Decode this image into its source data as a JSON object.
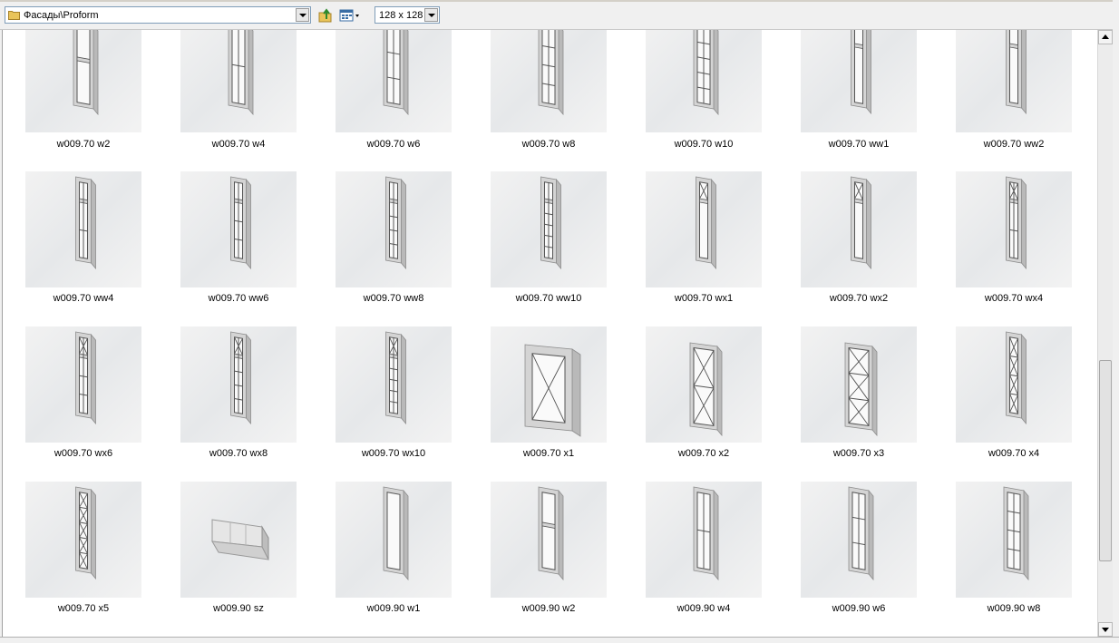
{
  "toolbar": {
    "path": "Фасады\\Proform",
    "view_size": "128 x 128",
    "icons": [
      "folder-icon",
      "up-folder-icon",
      "view-mode-icon",
      "dropdown-arrow-icon"
    ]
  },
  "grid": {
    "items": [
      {
        "label": "w009.70 w2",
        "shape": "tall",
        "pattern": "w2"
      },
      {
        "label": "w009.70 w4",
        "shape": "tall",
        "pattern": "w4"
      },
      {
        "label": "w009.70 w6",
        "shape": "tall",
        "pattern": "w6"
      },
      {
        "label": "w009.70 w8",
        "shape": "tall",
        "pattern": "w8"
      },
      {
        "label": "w009.70 w10",
        "shape": "tall",
        "pattern": "w10"
      },
      {
        "label": "w009.70 ww1",
        "shape": "narrow",
        "pattern": "ww1"
      },
      {
        "label": "w009.70 ww2",
        "shape": "narrow",
        "pattern": "ww2"
      },
      {
        "label": "w009.70 ww4",
        "shape": "narrow",
        "pattern": "ww4"
      },
      {
        "label": "w009.70 ww6",
        "shape": "narrow",
        "pattern": "ww6"
      },
      {
        "label": "w009.70 ww8",
        "shape": "narrow",
        "pattern": "ww8"
      },
      {
        "label": "w009.70 ww10",
        "shape": "narrow",
        "pattern": "ww10"
      },
      {
        "label": "w009.70 wx1",
        "shape": "narrow",
        "pattern": "wx1"
      },
      {
        "label": "w009.70 wx2",
        "shape": "narrow",
        "pattern": "wx2"
      },
      {
        "label": "w009.70 wx4",
        "shape": "narrow",
        "pattern": "wx4"
      },
      {
        "label": "w009.70 wx6",
        "shape": "narrow",
        "pattern": "wx6"
      },
      {
        "label": "w009.70 wx8",
        "shape": "narrow",
        "pattern": "wx8"
      },
      {
        "label": "w009.70 wx10",
        "shape": "narrow",
        "pattern": "wx10"
      },
      {
        "label": "w009.70 x1",
        "shape": "square",
        "pattern": "x1"
      },
      {
        "label": "w009.70 x2",
        "shape": "mid",
        "pattern": "x2"
      },
      {
        "label": "w009.70 x3",
        "shape": "mid",
        "pattern": "x3"
      },
      {
        "label": "w009.70 x4",
        "shape": "narrow",
        "pattern": "x4"
      },
      {
        "label": "w009.70 x5",
        "shape": "narrow",
        "pattern": "x5"
      },
      {
        "label": "w009.90 sz",
        "shape": "panel",
        "pattern": "sz"
      },
      {
        "label": "w009.90 w1",
        "shape": "tall",
        "pattern": "w1"
      },
      {
        "label": "w009.90 w2",
        "shape": "tall",
        "pattern": "w2"
      },
      {
        "label": "w009.90 w4",
        "shape": "tall",
        "pattern": "v4"
      },
      {
        "label": "w009.90 w6",
        "shape": "tall",
        "pattern": "v6"
      },
      {
        "label": "w009.90 w8",
        "shape": "tall",
        "pattern": "v8"
      }
    ]
  }
}
